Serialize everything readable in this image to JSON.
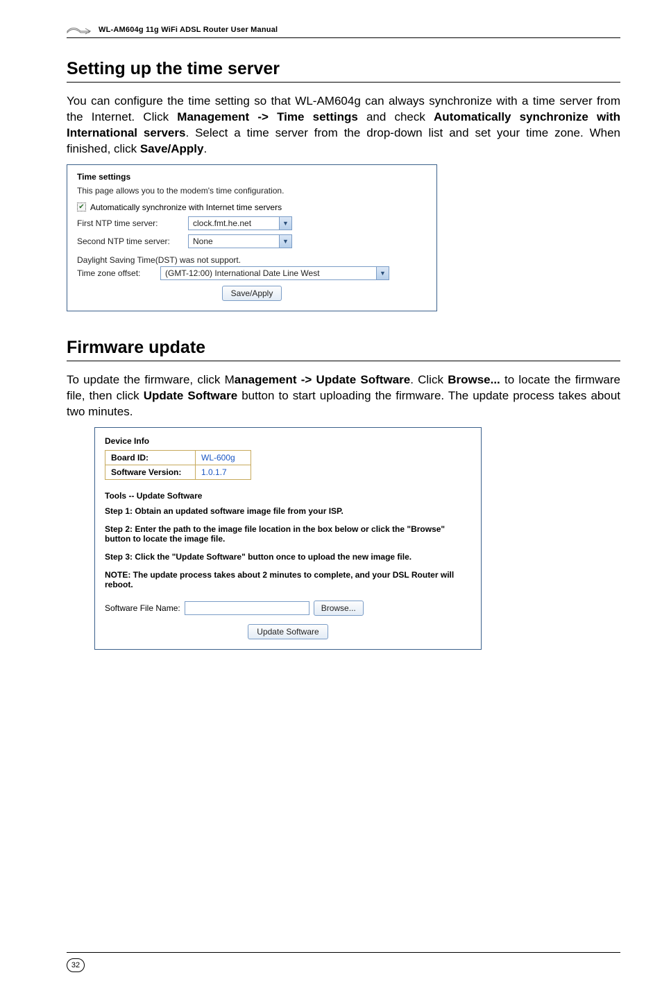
{
  "header": {
    "title": "WL-AM604g 11g WiFi ADSL Router User Manual"
  },
  "section_time": {
    "heading": "Setting up the time server",
    "body_before": "You can configure the time setting so that WL-AM604g can always synchronize with a time server from the Internet. Click ",
    "bold1": "Management -> Time settings",
    "body_mid1": " and check ",
    "bold2": "Automatically synchronize with International servers",
    "body_mid2": ". Select a time server from the drop-down list and set your time zone. When finished, click ",
    "bold3": "Save/Apply",
    "body_after": "."
  },
  "time_panel": {
    "title": "Time settings",
    "desc": "This page allows you to the modem's time configuration.",
    "checkbox_label": "Automatically synchronize with Internet time servers",
    "ntp1_label": "First NTP time server:",
    "ntp1_value": "clock.fmt.he.net",
    "ntp2_label": "Second NTP time server:",
    "ntp2_value": "None",
    "dst_note": "Daylight Saving Time(DST) was not support.",
    "tz_label": "Time zone offset:",
    "tz_value": "(GMT-12:00) International Date Line West",
    "save_btn": "Save/Apply"
  },
  "section_fw": {
    "heading": "Firmware update",
    "body_before": "To update the firmware, click M",
    "bold1": "anagement -> Update Software",
    "body_mid1": ". Click ",
    "bold2": "Browse...",
    "body_mid2": " to locate the firmware file, then click ",
    "bold3": "Update Software",
    "body_after": " button to start uploading the firmware. The update process takes about two minutes."
  },
  "update_panel": {
    "device_title": "Device Info",
    "board_k": "Board ID:",
    "board_v": "WL-600g",
    "sw_k": "Software Version:",
    "sw_v": "1.0.1.7",
    "tools_title": "Tools -- Update Software",
    "step1": "Step 1: Obtain an updated software image file from your ISP.",
    "step2": "Step 2: Enter the path to the image file location in the box below or click the \"Browse\" button to locate the image file.",
    "step3": "Step 3: Click the \"Update Software\" button once to upload the new image file.",
    "note": "NOTE: The update process takes about 2 minutes to complete, and your DSL Router will reboot.",
    "file_label": "Software File Name:",
    "browse_btn": "Browse...",
    "update_btn": "Update Software"
  },
  "page_number": "32"
}
